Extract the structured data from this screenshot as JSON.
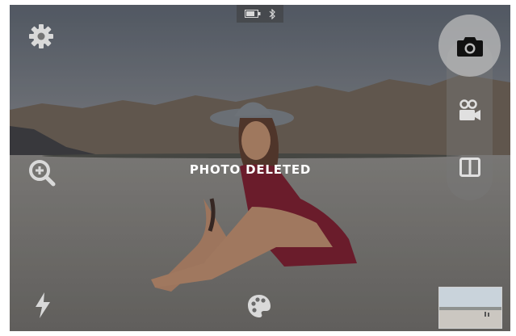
{
  "status_bar": {
    "battery_icon": "battery-icon",
    "bluetooth_icon": "bluetooth-icon"
  },
  "controls": {
    "settings_icon": "gear-icon",
    "zoom_icon": "zoom-in-icon",
    "flash_icon": "lightning-icon",
    "filters_icon": "palette-icon"
  },
  "mode_switcher": {
    "photo_icon": "camera-icon",
    "video_icon": "video-camera-icon",
    "split_icon": "split-view-icon",
    "active": "photo"
  },
  "message": {
    "text": "PHOTO DELETED"
  },
  "gallery": {
    "thumbnail": "last-photo-thumbnail"
  },
  "colors": {
    "icon": "#e6e6e6",
    "message_text": "#ffffff",
    "shutter_bg": "#bebebe",
    "camera_glyph": "#111111"
  }
}
